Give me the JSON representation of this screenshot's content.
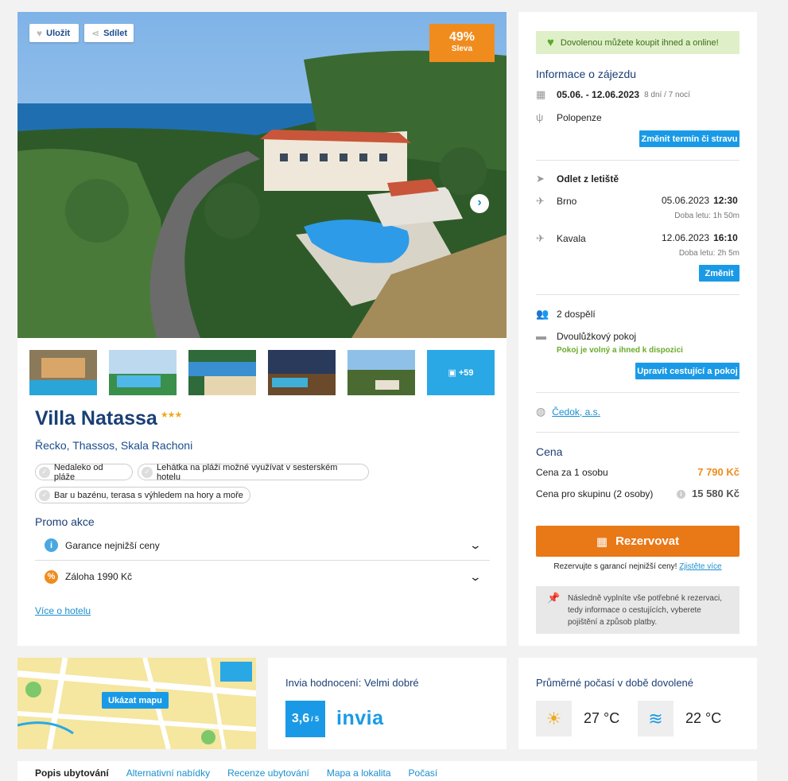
{
  "hero": {
    "save_label": "Uložit",
    "share_label": "Sdílet",
    "discount_pct": "49%",
    "discount_label": "Sleva",
    "more_photos": "+59"
  },
  "hotel": {
    "name": "Villa Natassa",
    "stars": "★★★",
    "location": "Řecko, Thassos, Skala Rachoni",
    "tags": [
      "Nedaleko od pláže",
      "Lehátka na pláži možné využívat v sesterském hotelu",
      "Bar u bazénu, terasa s výhledem na hory a moře"
    ],
    "more_link": "Více o hotelu"
  },
  "promo": {
    "title": "Promo akce",
    "items": [
      "Garance nejnižší ceny",
      "Záloha 1990 Kč"
    ]
  },
  "trip": {
    "banner": "Dovolenou můžete koupit ihned a online!",
    "title": "Informace o zájezdu",
    "dates": "05.06. - 12.06.2023",
    "nights": "8 dní / 7 nocí",
    "board": "Polopenze",
    "change_date_btn": "Změnit termín či stravu",
    "departure_label": "Odlet z letiště",
    "outbound": {
      "city": "Brno",
      "date": "05.06.2023",
      "time": "12:30",
      "duration": "Doba letu: 1h 50m"
    },
    "inbound": {
      "city": "Kavala",
      "date": "12.06.2023",
      "time": "16:10",
      "duration": "Doba letu: 2h 5m"
    },
    "change_btn": "Změnit",
    "travelers": "2 dospělí",
    "room": "Dvoulůžkový pokoj",
    "room_note": "Pokoj je volný a ihned k dispozici",
    "edit_travelers_btn": "Upravit cestující a pokoj",
    "agency": "Čedok, a.s."
  },
  "price": {
    "title": "Cena",
    "per_person_label": "Cena za 1 osobu",
    "per_person_value": "7 790 Kč",
    "group_label": "Cena pro skupinu (2 osoby)",
    "group_value": "15 580 Kč",
    "reserve_btn": "Rezervovat",
    "guarantee_text": "Rezervujte s garancí nejnižší ceny!",
    "guarantee_link": "Zjistěte více",
    "note": "Následně vyplníte vše potřebné k rezervaci, tedy informace o cestujících, vyberete pojištění a způsob platby."
  },
  "map": {
    "button": "Ukázat mapu"
  },
  "rating": {
    "title": "Invia hodnocení: Velmi dobré",
    "score": "3,6",
    "scale": "/ 5",
    "logo": "invia"
  },
  "weather": {
    "title": "Průměrné počasí v době dovolené",
    "air_temp": "27 °C",
    "water_temp": "22 °C"
  },
  "tabs": [
    "Popis ubytování",
    "Alternativní nabídky",
    "Recenze ubytování",
    "Mapa a lokalita",
    "Počasí"
  ],
  "colors": {
    "accent_blue": "#1a9ae6",
    "orange": "#e97816",
    "navy": "#1a3f75",
    "green": "#5aaa28"
  }
}
